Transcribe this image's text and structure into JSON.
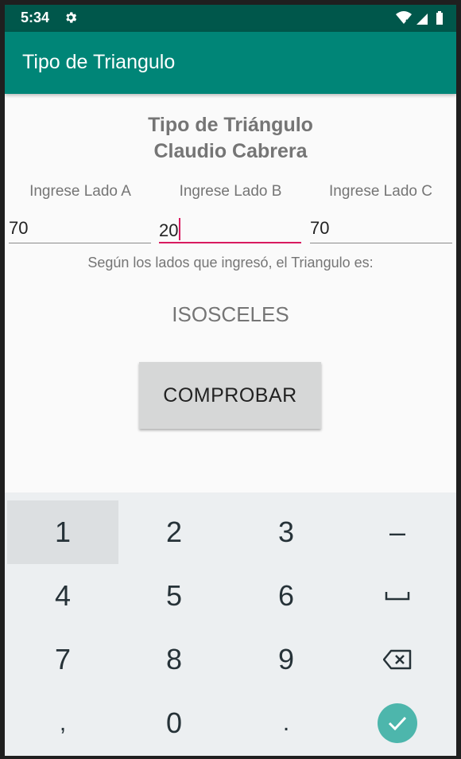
{
  "status_bar": {
    "time": "5:34"
  },
  "app_bar": {
    "title": "Tipo de Triangulo"
  },
  "headings": {
    "line1": "Tipo de Triángulo",
    "line2": "Claudio Cabrera"
  },
  "inputs": [
    {
      "label": "Ingrese Lado A",
      "value": "70"
    },
    {
      "label": "Ingrese Lado B",
      "value": "20"
    },
    {
      "label": "Ingrese Lado C",
      "value": "70"
    }
  ],
  "result": {
    "label": "Según los lados que ingresó, el Triangulo es:",
    "value": "ISOSCELES"
  },
  "button": {
    "label": "COMPROBAR"
  },
  "keyboard": {
    "keys": [
      "1",
      "2",
      "3",
      "–",
      "4",
      "5",
      "6",
      "7",
      "8",
      "9",
      ",",
      "0",
      "."
    ]
  },
  "colors": {
    "status_bar": "#00574b",
    "app_bar": "#008577",
    "accent": "#d81b60",
    "done_key": "#4db6ac"
  }
}
